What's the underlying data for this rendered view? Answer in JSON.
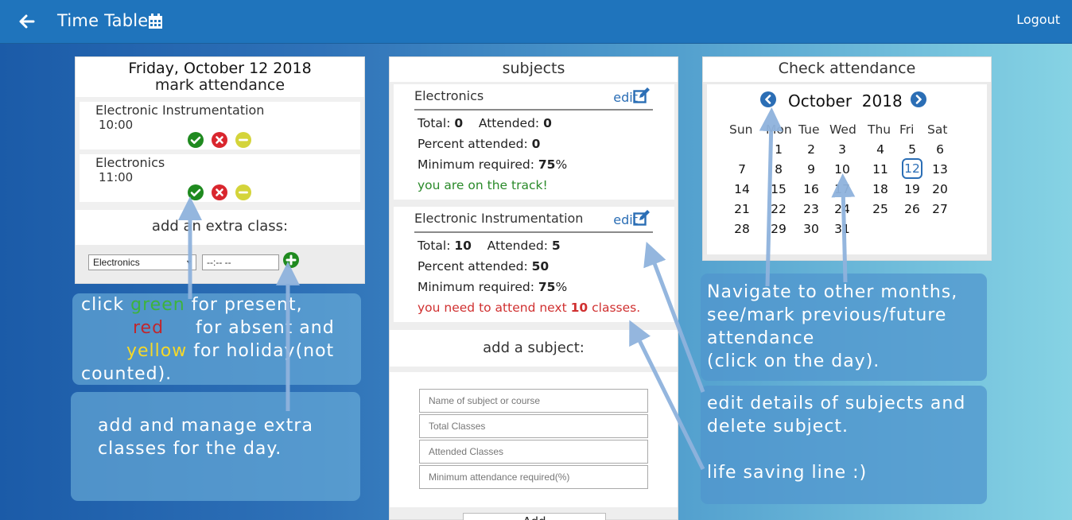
{
  "header": {
    "title": "Time Table",
    "logout_label": "Logout"
  },
  "mark_panel": {
    "date": "Friday, October 12 2018",
    "subtitle": "mark attendance",
    "classes": [
      {
        "name": "Electronic Instrumentation",
        "time": "10:00"
      },
      {
        "name": "Electronics",
        "time": "11:00"
      }
    ],
    "extra_title": "add an extra class:",
    "extra_select_value": "Electronics",
    "extra_time_value": "--:--  --"
  },
  "subjects_panel": {
    "title": "subjects",
    "edit_label": "edit",
    "subjects": [
      {
        "name": "Electronics",
        "total_label": "Total:",
        "total": "0",
        "attended_label": "Attended:",
        "attended": "0",
        "percent_label": "Percent attended:",
        "percent": "0",
        "min_label": "Minimum required:",
        "min": "75",
        "min_unit": "%",
        "status": "you are on the track!"
      },
      {
        "name": "Electronic Instrumentation",
        "total_label": "Total:",
        "total": "10",
        "attended_label": "Attended:",
        "attended": "5",
        "percent_label": "Percent attended:",
        "percent": "50",
        "min_label": "Minimum required:",
        "min": "75",
        "min_unit": "%",
        "status_pre": "you need to attend next ",
        "status_num": "10",
        "status_post": " classes."
      }
    ],
    "add_title": "add a subject:",
    "fields": [
      {
        "placeholder": "Name of subject or course"
      },
      {
        "placeholder": "Total Classes"
      },
      {
        "placeholder": "Attended Classes"
      },
      {
        "placeholder": "Minimum attendance required(%)"
      }
    ],
    "add_button": "Add"
  },
  "calendar_panel": {
    "title": "Check attendance",
    "month": "October",
    "year": "2018",
    "weekdays": [
      "Sun",
      "Mon",
      "Tue",
      "Wed",
      "Thu",
      "Fri",
      "Sat"
    ],
    "days": [
      "1",
      "2",
      "3",
      "4",
      "5",
      "6",
      "7",
      "8",
      "9",
      "10",
      "11",
      "12",
      "13",
      "14",
      "15",
      "16",
      "17",
      "18",
      "19",
      "20",
      "21",
      "22",
      "23",
      "24",
      "25",
      "26",
      "27",
      "28",
      "29",
      "30",
      "31"
    ],
    "first_weekday_index": 1,
    "today": "12"
  },
  "notes": {
    "colors_l1_pre": "click ",
    "colors_green": "green",
    "colors_l1_post": " for present,",
    "colors_red": "red",
    "colors_l2_post": "for absent and",
    "colors_yellow": "yellow",
    "colors_l3_post": " for holiday(not",
    "colors_l4": "counted).",
    "extra_l1": "add and manage extra",
    "extra_l2": "classes for the day.",
    "nav_l1": "Navigate to other months,",
    "nav_l2": "see/mark previous/future",
    "nav_l3": "attendance",
    "nav_l4": "(click on the day).",
    "edit_l1": "edit details of subjects and",
    "edit_l2": "delete subject.",
    "life_line": "life saving line :)"
  },
  "colors": {
    "header": "#1f74bc",
    "green": "#1f8a1f",
    "red": "#d9262e",
    "yellow": "#d4d43a",
    "accent": "#2b6eb5"
  }
}
